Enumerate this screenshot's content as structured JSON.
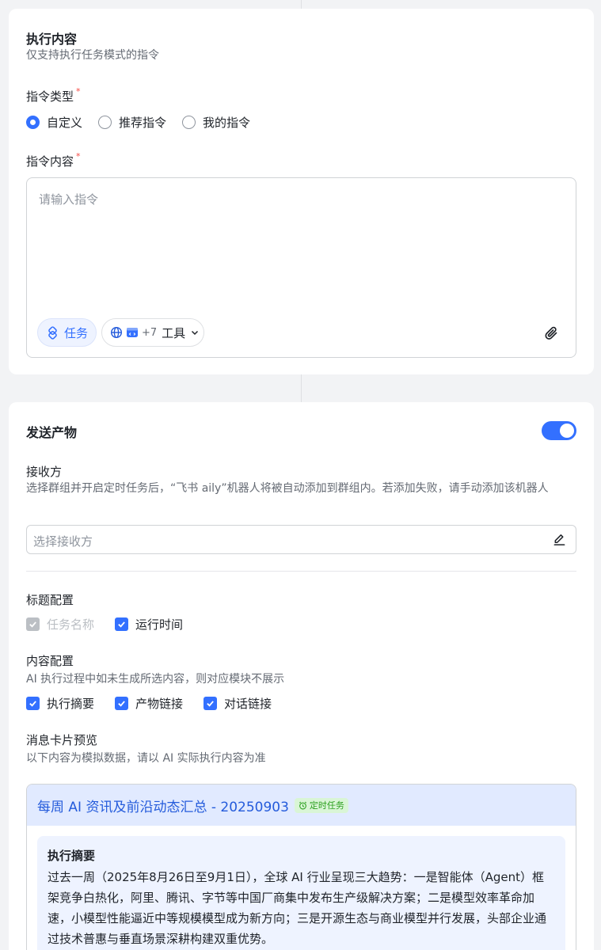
{
  "execution": {
    "title": "执行内容",
    "subtitle": "仅支持执行任务模式的指令",
    "instruction_type_label": "指令类型",
    "required_mark": "*",
    "radio_options": [
      {
        "label": "自定义",
        "selected": true
      },
      {
        "label": "推荐指令",
        "selected": false
      },
      {
        "label": "我的指令",
        "selected": false
      }
    ],
    "instruction_content_label": "指令内容",
    "instruction_placeholder": "请输入指令",
    "task_chip_label": "任务",
    "tools_count": "+7",
    "tools_label": "工具"
  },
  "send_output": {
    "title": "发送产物",
    "toggle_on": true,
    "receiver_label": "接收方",
    "receiver_desc": "选择群组并开启定时任务后，“飞书 aily”机器人将被自动添加到群组内。若添加失败，请手动添加该机器人",
    "receiver_placeholder": "选择接收方",
    "title_config_label": "标题配置",
    "title_options": [
      {
        "label": "任务名称",
        "checked": true,
        "disabled": true
      },
      {
        "label": "运行时间",
        "checked": true,
        "disabled": false
      }
    ],
    "content_config_label": "内容配置",
    "content_config_desc": "AI 执行过程中如未生成所选内容，则对应模块不展示",
    "content_options": [
      {
        "label": "执行摘要",
        "checked": true
      },
      {
        "label": "产物链接",
        "checked": true
      },
      {
        "label": "对话链接",
        "checked": true
      }
    ],
    "preview_label": "消息卡片预览",
    "preview_desc": "以下内容为模拟数据，请以 AI 实际执行内容为准",
    "card": {
      "title": "每周 AI 资讯及前沿动态汇总 - 20250903",
      "badge": "定时任务",
      "summary_title": "执行摘要",
      "summary_text": "过去一周（2025年8月26日至9月1日），全球 AI 行业呈现三大趋势：一是智能体（Agent）框架竞争白热化，阿里、腾讯、字节等中国厂商集中发布生产级解决方案；二是模型效率革命加速，小模型性能逼近中等规模模型成为新方向；三是开源生态与商业模型并行发展，头部企业通过技术普惠与垂直场景深耕构建双重优势。"
    }
  },
  "colors": {
    "accent": "#3370ff",
    "background": "#f2f3f5",
    "required": "#f54a45",
    "badge_green": "#2ea121"
  }
}
